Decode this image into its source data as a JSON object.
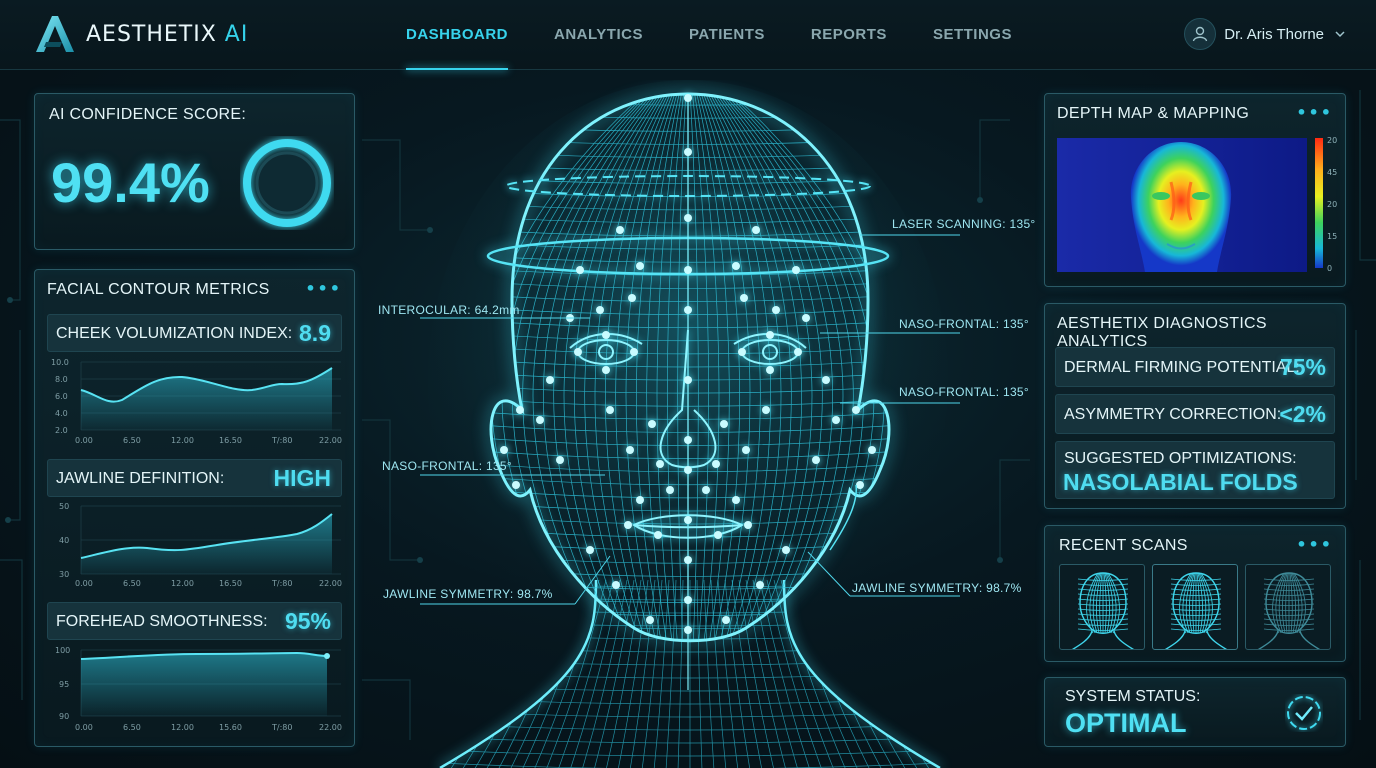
{
  "app": {
    "brand_name": "AESTHETIX",
    "brand_suffix": "AI",
    "accent_color": "#37d3ec"
  },
  "nav": {
    "items": [
      {
        "label": "DASHBOARD",
        "active": true
      },
      {
        "label": "ANALYTICS",
        "active": false
      },
      {
        "label": "PATIENTS",
        "active": false
      },
      {
        "label": "REPORTS",
        "active": false
      },
      {
        "label": "SETTINGS",
        "active": false
      }
    ]
  },
  "user": {
    "name": "Dr. Aris Thorne",
    "icon": "user-icon"
  },
  "confidence": {
    "title": "AI CONFIDENCE SCORE:",
    "value": "99.4%",
    "ring_fill": 0.994
  },
  "contour": {
    "title": "FACIAL CONTOUR METRICS",
    "menu": "•••",
    "metrics": [
      {
        "label": "CHEEK VOLUMIZATION INDEX:",
        "value": "8.9",
        "chart": {
          "type": "area",
          "y_ticks": [
            "10.0",
            "8.0",
            "6.0",
            "4.0",
            "2.0"
          ],
          "x_ticks": [
            "0.00",
            "6.50",
            "12.00",
            "16.50",
            "T/:80",
            "22.00"
          ]
        }
      },
      {
        "label": "JAWLINE DEFINITION:",
        "value": "HIGH",
        "chart": {
          "type": "area",
          "y_ticks": [
            "50",
            "40",
            "30"
          ],
          "x_ticks": [
            "0.00",
            "6.50",
            "12.00",
            "16.50",
            "T/:80",
            "22.00"
          ]
        }
      },
      {
        "label": "FOREHEAD SMOOTHNESS:",
        "value": "95%",
        "chart": {
          "type": "area",
          "y_ticks": [
            "100",
            "95",
            "90"
          ],
          "x_ticks": [
            "0.00",
            "6.50",
            "12.00",
            "15.60",
            "T/:80",
            "22.00"
          ]
        }
      }
    ]
  },
  "callouts": {
    "interocular": "INTEROCULAR: 64.2mm",
    "laser": "LASER SCANNING: 135°",
    "naso_frontal": "NASO-FRONTAL: 135°",
    "jawline_symmetry": "JAWLINE SYMMETRY: 98.7%",
    "jawline_symmetry_right": "JAWLINE SYMMETRY: 98.7%"
  },
  "depth": {
    "title": "DEPTH MAP & MAPPING",
    "menu": "•••",
    "scale": [
      "20",
      "45",
      "20",
      "15",
      "0"
    ]
  },
  "diagnostics": {
    "title": "AESTHETIX DIAGNOSTICS ANALYTICS",
    "rows": [
      {
        "label": "DERMAL FIRMING POTENTIAL:",
        "value": "75%"
      },
      {
        "label": "ASYMMETRY CORRECTION:",
        "value": "<2%"
      }
    ],
    "suggested_label": "SUGGESTED OPTIMIZATIONS:",
    "suggested_value": "NASOLABIAL FOLDS"
  },
  "recent": {
    "title": "RECENT SCANS",
    "menu": "•••"
  },
  "status": {
    "label": "SYSTEM STATUS:",
    "value": "OPTIMAL",
    "icon": "check-circle-icon"
  }
}
